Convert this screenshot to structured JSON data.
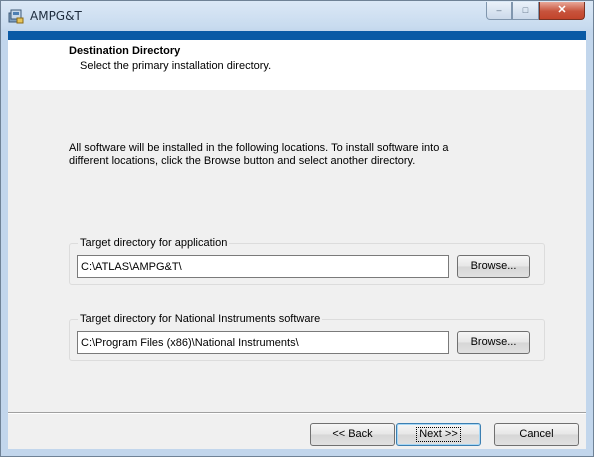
{
  "window": {
    "title": "AMPG&T",
    "icon": "installer-icon",
    "controls": {
      "minimize": "–",
      "maximize": "□",
      "close": "✕"
    }
  },
  "header": {
    "title": "Destination Directory",
    "subtitle": "Select the primary installation directory."
  },
  "body": {
    "intro_line1": "All software will be installed in the following locations. To install software into a",
    "intro_line2": "different locations, click the Browse button and select another directory."
  },
  "groups": [
    {
      "label": "Target directory for application",
      "path": "C:\\ATLAS\\AMPG&T\\",
      "browse_label": "Browse..."
    },
    {
      "label": "Target directory for National Instruments software",
      "path": "C:\\Program Files (x86)\\National Instruments\\",
      "browse_label": "Browse..."
    }
  ],
  "footer": {
    "back_label": "<< Back",
    "next_label": "Next >>",
    "cancel_label": "Cancel"
  },
  "colors": {
    "accent_bar": "#0a5aa5",
    "client_bg": "#f0f0f0",
    "close_button": "#c7533c"
  }
}
